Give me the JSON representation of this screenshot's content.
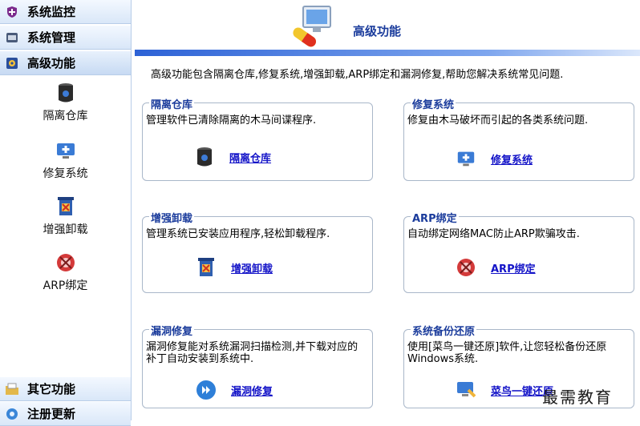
{
  "sidebar": {
    "categories": [
      {
        "label": "系统监控",
        "icon": "shield-icon"
      },
      {
        "label": "系统管理",
        "icon": "manage-icon"
      },
      {
        "label": "高级功能",
        "icon": "gear-icon"
      }
    ],
    "sub_items": [
      {
        "label": "隔离仓库",
        "icon": "quarantine-icon"
      },
      {
        "label": "修复系统",
        "icon": "repair-icon"
      },
      {
        "label": "增强卸载",
        "icon": "uninstall-icon"
      },
      {
        "label": "ARP绑定",
        "icon": "arp-icon"
      }
    ],
    "bottom": [
      {
        "label": "其它功能",
        "icon": "folder-icon"
      },
      {
        "label": "注册更新",
        "icon": "update-icon"
      }
    ]
  },
  "main": {
    "title": "高级功能",
    "intro": "高级功能包含隔离仓库,修复系统,增强卸载,ARP绑定和漏洞修复,帮助您解决系统常见问题.",
    "boxes": [
      {
        "title": "隔离仓库",
        "desc": "管理软件已清除隔离的木马间谍程序.",
        "link": "隔离仓库",
        "icon": "quarantine-icon"
      },
      {
        "title": "修复系统",
        "desc": "修复由木马破坏而引起的各类系统问题.",
        "link": "修复系统",
        "icon": "repair-icon"
      },
      {
        "title": "增强卸载",
        "desc": "管理系统已安装应用程序,轻松卸载程序.",
        "link": "增强卸载",
        "icon": "uninstall-icon"
      },
      {
        "title": "ARP绑定",
        "desc": "自动绑定网络MAC防止ARP欺骗攻击.",
        "link": "ARP绑定",
        "icon": "arp-icon"
      },
      {
        "title": "漏洞修复",
        "desc": "漏洞修复能对系统漏洞扫描检测,并下载对应的补丁自动安装到系统中.",
        "link": "漏洞修复",
        "icon": "play-icon"
      },
      {
        "title": "系统备份还原",
        "desc": "使用[菜鸟一键还原]软件,让您轻松备份还原Windows系统.",
        "link": "菜鸟一键还原",
        "icon": "backup-icon"
      }
    ]
  },
  "watermark": "最需教育",
  "colors": {
    "accent": "#1b3c9c",
    "link": "#1414c8",
    "bar": "#2d62d6"
  }
}
